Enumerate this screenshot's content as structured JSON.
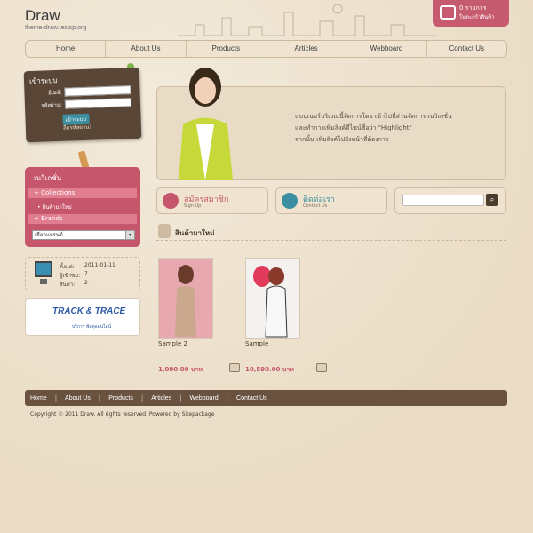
{
  "header": {
    "site_title": "Draw",
    "site_subtitle": "theme-draw.testsp.org",
    "cart": {
      "count": "0 รายการ",
      "label": "ในตะกร้าสินค้า"
    }
  },
  "nav": [
    "Home",
    "About Us",
    "Products",
    "Articles",
    "Webboard",
    "Contact Us"
  ],
  "login": {
    "title": "เข้าระบบ",
    "email_label": "อีเมล์:",
    "password_label": "รหัสผ่าน:",
    "submit_label": "เข้าระบบ",
    "forgot_label": "ลืมรหัสผ่าน?"
  },
  "categories": {
    "title": "เนวิเกชั่น",
    "collections_label": "+ Collections",
    "collections_sub": "สินค้ามาใหม่",
    "brands_label": "+ Brands",
    "brand_select": "เลือกแบรนด์"
  },
  "stats": {
    "rows": [
      {
        "k": "ตั้งแต่:",
        "v": "2011-01-11"
      },
      {
        "k": "ผู้เข้าชม:",
        "v": "7"
      },
      {
        "k": "สินค้า:",
        "v": "2"
      }
    ]
  },
  "track": {
    "title": "TRACK & TRACE",
    "sub": "บริการ พัสดุออนไลน์"
  },
  "banner": {
    "text": "แบนเนอร์บริเวณนี้จัดการโดย เข้าไปที่ส่วนจัดการ เนวิเกชั่น\nและทำการเพิ่มลิงค์ดีไซน์ชื่อว่า \"Highlight\"\nจากนั้น เพิ่มลิงค์ไปยังหน้าที่ต้องการ"
  },
  "signup": {
    "title": "สมัครสมาชิก",
    "sub": "Sign Up"
  },
  "contact": {
    "title": "ติดต่อเรา",
    "sub": "Contact Us"
  },
  "products": {
    "section_title": "สินค้ามาใหม่",
    "items": [
      {
        "name": "Sample 2",
        "price": "1,090.00 บาท"
      },
      {
        "name": "Sample",
        "price": "10,590.00 บาท"
      }
    ]
  },
  "footer": {
    "nav": [
      "Home",
      "About Us",
      "Products",
      "Articles",
      "Webboard",
      "Contact Us"
    ],
    "copyright": "Copyright © 2011 Draw. All rights reserved. Powered by Sitepackage"
  },
  "colors": {
    "accent_pink": "#c65a6e",
    "dark_brown": "#5a4636",
    "teal": "#3c8fa0"
  },
  "icons": [
    "cart-icon",
    "pencil-icon",
    "phone-icon",
    "search-icon",
    "shirt-icon",
    "monitor-icon",
    "add-to-cart-icon"
  ]
}
